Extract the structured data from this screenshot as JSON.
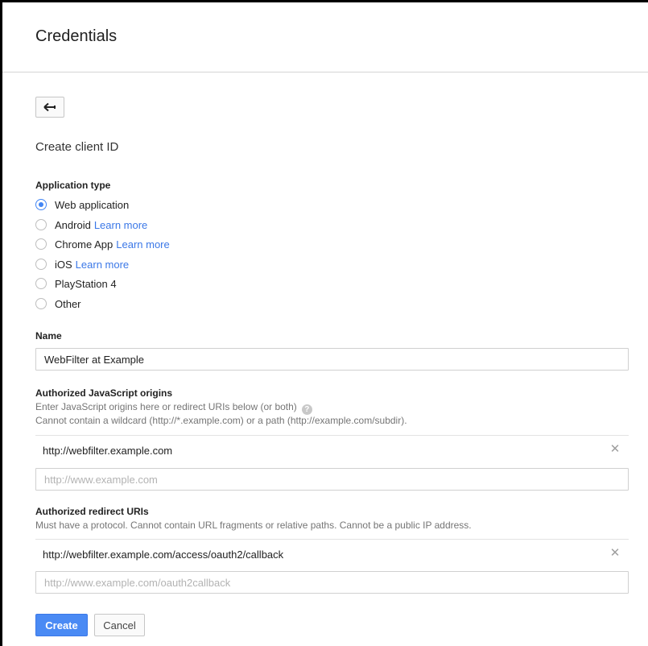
{
  "header": {
    "title": "Credentials"
  },
  "form": {
    "subtitle": "Create client ID",
    "application_type": {
      "label": "Application type",
      "options": [
        {
          "label": "Web application",
          "link": "",
          "checked": true
        },
        {
          "label": "Android",
          "link": "Learn more",
          "checked": false
        },
        {
          "label": "Chrome App",
          "link": "Learn more",
          "checked": false
        },
        {
          "label": "iOS",
          "link": "Learn more",
          "checked": false
        },
        {
          "label": "PlayStation 4",
          "link": "",
          "checked": false
        },
        {
          "label": "Other",
          "link": "",
          "checked": false
        }
      ]
    },
    "name": {
      "label": "Name",
      "value": "WebFilter at Example"
    },
    "js_origins": {
      "label": "Authorized JavaScript origins",
      "help1": "Enter JavaScript origins here or redirect URIs below (or both)",
      "help2": "Cannot contain a wildcard (http://*.example.com) or a path (http://example.com/subdir).",
      "entries": [
        "http://webfilter.example.com"
      ],
      "placeholder": "http://www.example.com"
    },
    "redirect_uris": {
      "label": "Authorized redirect URIs",
      "help": "Must have a protocol. Cannot contain URL fragments or relative paths. Cannot be a public IP address.",
      "entries": [
        "http://webfilter.example.com/access/oauth2/callback"
      ],
      "placeholder": "http://www.example.com/oauth2callback"
    },
    "buttons": {
      "create": "Create",
      "cancel": "Cancel"
    }
  },
  "icons": {
    "back": "back-arrow-icon",
    "remove": "close-icon",
    "help": "help-icon"
  },
  "colors": {
    "accent": "#4285f4",
    "link": "#3b78e7",
    "primary_button": "#4a8af4"
  }
}
